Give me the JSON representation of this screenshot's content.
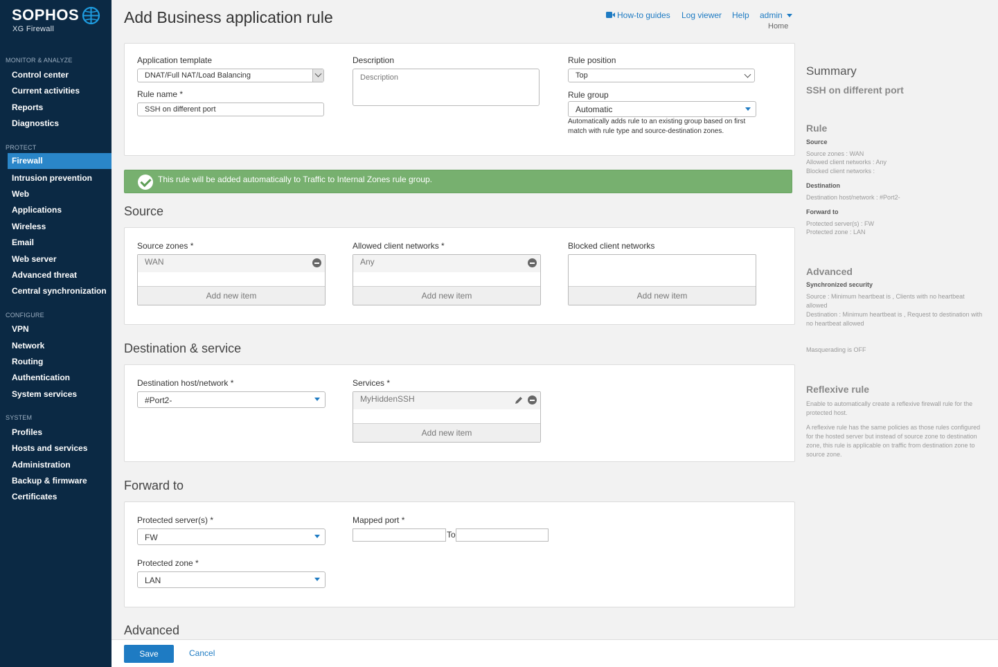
{
  "brand": {
    "name": "SOPHOS",
    "product": "XG Firewall"
  },
  "sidebar": {
    "sections": [
      {
        "label": "MONITOR & ANALYZE",
        "items": [
          "Control center",
          "Current activities",
          "Reports",
          "Diagnostics"
        ]
      },
      {
        "label": "PROTECT",
        "items": [
          "Firewall",
          "Intrusion prevention",
          "Web",
          "Applications",
          "Wireless",
          "Email",
          "Web server",
          "Advanced threat",
          "Central synchronization"
        ]
      },
      {
        "label": "CONFIGURE",
        "items": [
          "VPN",
          "Network",
          "Routing",
          "Authentication",
          "System services"
        ]
      },
      {
        "label": "SYSTEM",
        "items": [
          "Profiles",
          "Hosts and services",
          "Administration",
          "Backup & firmware",
          "Certificates"
        ]
      }
    ],
    "active": "Firewall"
  },
  "header": {
    "title": "Add Business application rule",
    "links": [
      "How-to guides",
      "Log viewer",
      "Help"
    ],
    "user": "admin",
    "home": "Home"
  },
  "general": {
    "template_label": "Application template",
    "template_value": "DNAT/Full NAT/Load Balancing",
    "rule_name_label": "Rule name *",
    "rule_name_value": "SSH on different port",
    "description_label": "Description",
    "description_placeholder": "Description",
    "position_label": "Rule position",
    "position_value": "Top",
    "group_label": "Rule group",
    "group_value": "Automatic",
    "group_help": "Automatically adds rule to an existing group based on first match with rule type and source-destination zones."
  },
  "banner": {
    "text": "This rule will be added automatically to Traffic to Internal Zones rule group."
  },
  "source": {
    "title": "Source",
    "zones_label": "Source zones *",
    "zones": [
      "WAN"
    ],
    "allowed_label": "Allowed client networks *",
    "allowed": [
      "Any"
    ],
    "blocked_label": "Blocked client networks",
    "add_label": "Add new item"
  },
  "destination": {
    "title": "Destination & service",
    "host_label": "Destination host/network *",
    "host_value": "#Port2-",
    "services_label": "Services *",
    "services": [
      "MyHiddenSSH"
    ]
  },
  "forward": {
    "title": "Forward to",
    "server_label": "Protected server(s) *",
    "server_value": "FW",
    "zone_label": "Protected zone *",
    "zone_value": "LAN",
    "mapped_label": "Mapped port *",
    "to_label": "To"
  },
  "advanced": {
    "title": "Advanced"
  },
  "summary": {
    "title": "Summary",
    "rule_name": "SSH on different port",
    "rule_heading": "Rule",
    "source_heading": "Source",
    "source_lines": [
      "Source zones : WAN",
      "Allowed client networks : Any",
      "Blocked client networks :"
    ],
    "destination_heading": "Destination",
    "destination_lines": [
      "Destination host/network : #Port2-"
    ],
    "forward_heading": "Forward to",
    "forward_lines": [
      "Protected server(s) : FW",
      "Protected zone : LAN"
    ],
    "advanced_heading": "Advanced",
    "sync_heading": "Synchronized security",
    "sync_source": "Source : Minimum heartbeat is , Clients with no heartbeat allowed",
    "sync_destination": "Destination : Minimum heartbeat is , Request to destination with no heartbeat allowed",
    "masquerading": "Masquerading is OFF",
    "reflexive_heading": "Reflexive rule",
    "reflexive_1": "Enable to automatically create a reflexive firewall rule for the protected host.",
    "reflexive_2": "A reflexive rule has the same policies as those rules configured for the hosted server but instead of source zone to destination zone, this rule is applicable on traffic from destination zone to source zone."
  },
  "footer": {
    "save": "Save",
    "cancel": "Cancel"
  },
  "colors": {
    "sidebar": "#0b2944",
    "accent": "#1e7bc3",
    "success": "#77b06f"
  }
}
